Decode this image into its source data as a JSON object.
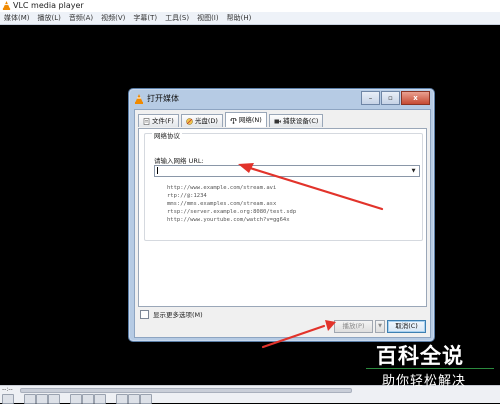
{
  "window": {
    "title": "VLC media player",
    "menu": [
      "媒体(M)",
      "播放(L)",
      "音频(A)",
      "视频(V)",
      "字幕(T)",
      "工具(S)",
      "视图(I)",
      "帮助(H)"
    ]
  },
  "playback": {
    "time_left": "--:--"
  },
  "dialog": {
    "title": "打开媒体",
    "window_buttons": {
      "minimize": "–",
      "maximize": "▫",
      "close": "x"
    },
    "tabs": [
      {
        "label": "文件(F)",
        "icon": "file-icon"
      },
      {
        "label": "光盘(D)",
        "icon": "disc-icon"
      },
      {
        "label": "网络(N)",
        "icon": "network-icon"
      },
      {
        "label": "捕获设备(C)",
        "icon": "capture-device-icon"
      }
    ],
    "active_tab": 2,
    "network": {
      "group_title": "网络协议",
      "url_label": "请输入网络 URL:",
      "url_value": "",
      "examples": [
        "http://www.example.com/stream.avi",
        "rtp://@:1234",
        "mms://mms.examples.com/stream.asx",
        "rtsp://server.example.org:8080/test.sdp",
        "http://www.yourtube.com/watch?v=gg64x"
      ]
    },
    "more_options_label": "显示更多选项(M)",
    "more_options_checked": false,
    "play_button": "播放(P)",
    "cancel_button": "取消(C)"
  },
  "watermark": {
    "title": "百科全说",
    "subtitle": "助你轻松解决"
  },
  "colors": {
    "annotation_arrow": "#e2332b",
    "dialog_frame": "#b6cbe4",
    "video_bg": "#000000"
  }
}
